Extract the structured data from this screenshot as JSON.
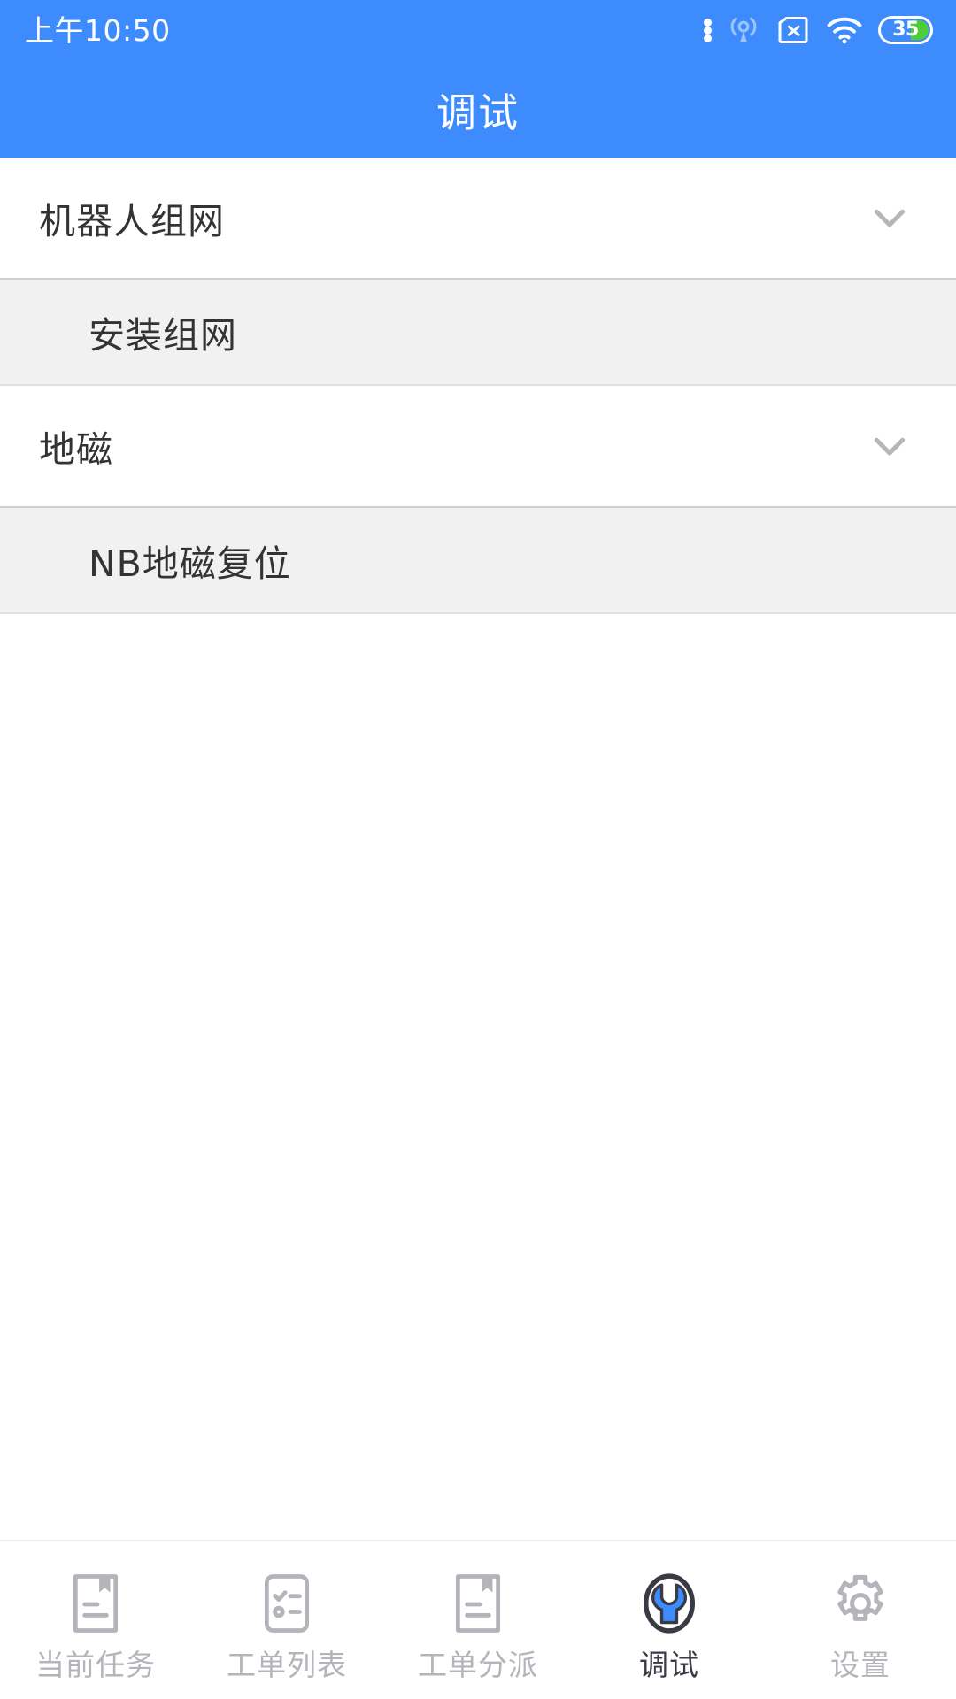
{
  "status_bar": {
    "time": "上午10:50",
    "battery_level": "35",
    "icons": [
      "more-dots-icon",
      "hotspot-icon",
      "sim-card-disabled-icon",
      "wifi-icon",
      "battery-icon"
    ]
  },
  "header": {
    "title": "调试",
    "background_color": "#3d8bfd",
    "text_color": "#ffffff"
  },
  "list": {
    "groups": [
      {
        "title": "机器人组网",
        "expanded": true,
        "chevron": "chevron-down-icon",
        "children": [
          {
            "title": "安装组网"
          }
        ]
      },
      {
        "title": "地磁",
        "expanded": true,
        "chevron": "chevron-down-icon",
        "children": [
          {
            "title": "NB地磁复位"
          }
        ]
      }
    ]
  },
  "tabbar": {
    "active_index": 3,
    "active_color": "#3a3a44",
    "inactive_color": "#b4b4bb",
    "accent_color": "#3d8bfd",
    "items": [
      {
        "label": "当前任务",
        "icon": "document-bookmark-icon"
      },
      {
        "label": "工单列表",
        "icon": "checklist-icon"
      },
      {
        "label": "工单分派",
        "icon": "document-bookmark-icon"
      },
      {
        "label": "调试",
        "icon": "wrench-circle-icon"
      },
      {
        "label": "设置",
        "icon": "gear-icon"
      }
    ]
  }
}
